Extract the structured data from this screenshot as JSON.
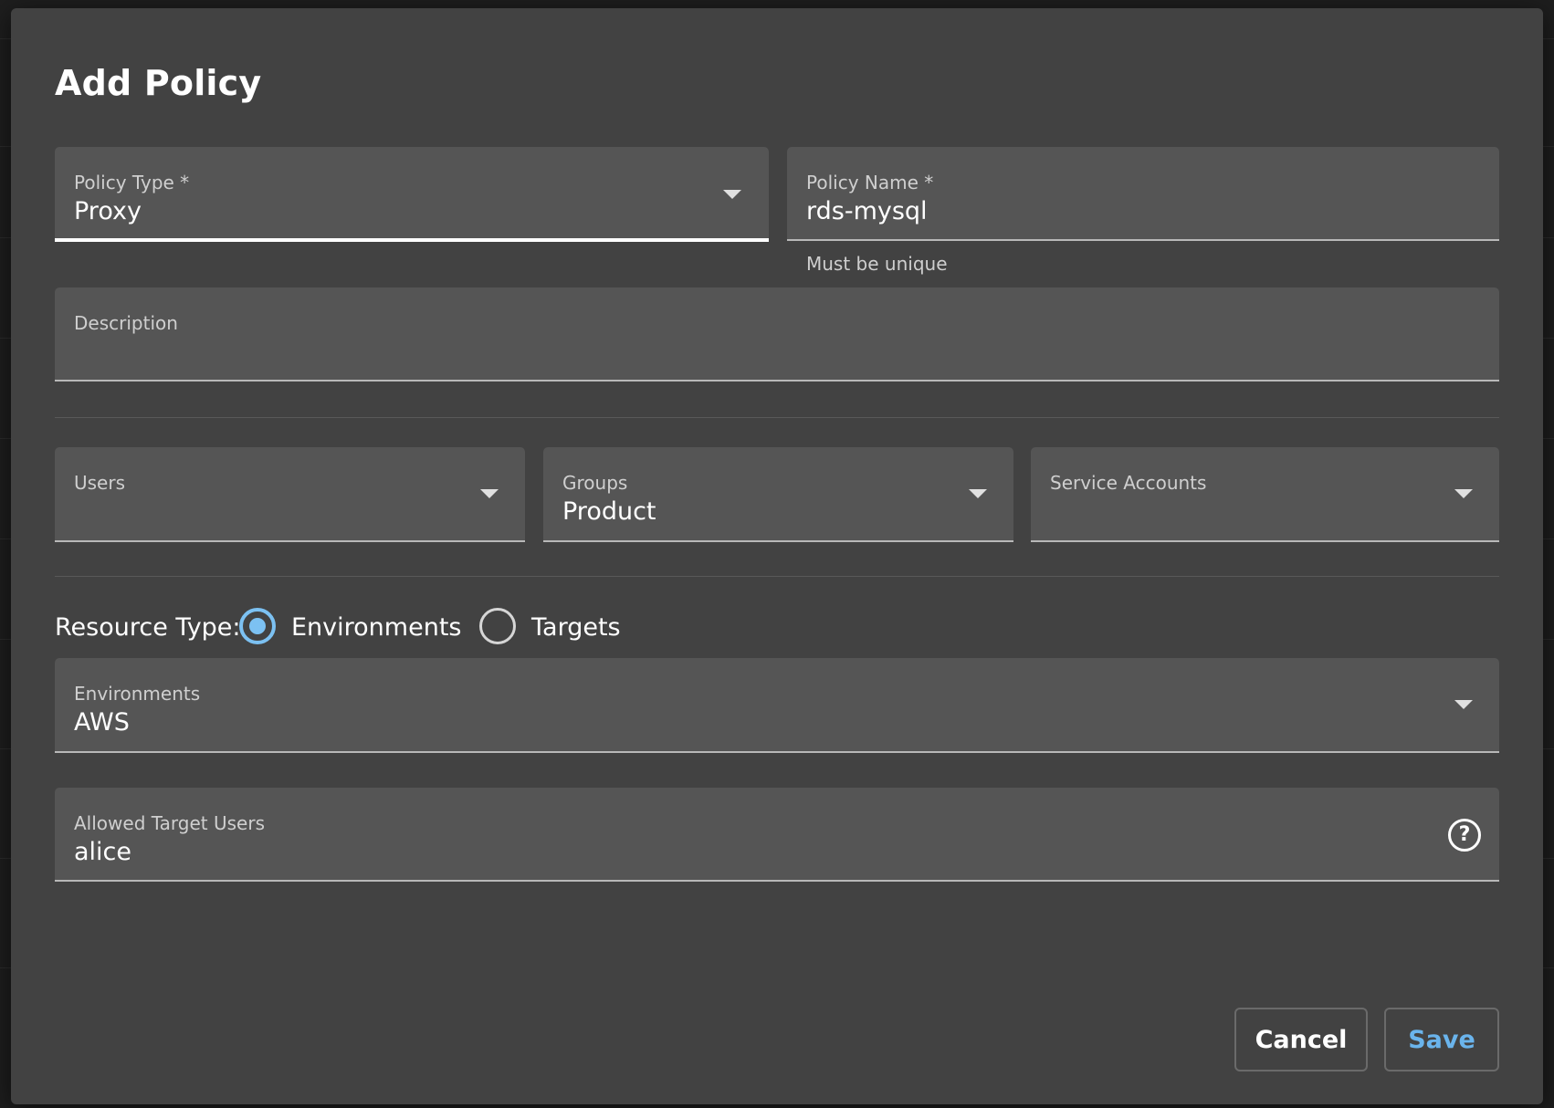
{
  "dialog": {
    "title": "Add Policy"
  },
  "form": {
    "policy_type": {
      "label": "Policy Type *",
      "value": "Proxy"
    },
    "policy_name": {
      "label": "Policy Name *",
      "value": "rds-mysql",
      "helper": "Must be unique"
    },
    "description": {
      "label": "Description",
      "value": ""
    },
    "users": {
      "label": "Users",
      "value": ""
    },
    "groups": {
      "label": "Groups",
      "value": "Product"
    },
    "service_accounts": {
      "label": "Service Accounts",
      "value": ""
    },
    "resource_type": {
      "label": "Resource Type:",
      "options": [
        {
          "label": "Environments",
          "checked": true
        },
        {
          "label": "Targets",
          "checked": false
        }
      ]
    },
    "environments": {
      "label": "Environments",
      "value": "AWS"
    },
    "allowed_target_users": {
      "label": "Allowed Target Users",
      "value": "alice"
    }
  },
  "actions": {
    "cancel_label": "Cancel",
    "save_label": "Save"
  },
  "icons": {
    "dropdown": "chevron-down-icon",
    "help": "help-circle-icon"
  },
  "colors": {
    "dialog_bg": "#424242",
    "field_bg": "#555555",
    "accent": "#7cc1f2",
    "save_text": "#6ab4ec"
  }
}
